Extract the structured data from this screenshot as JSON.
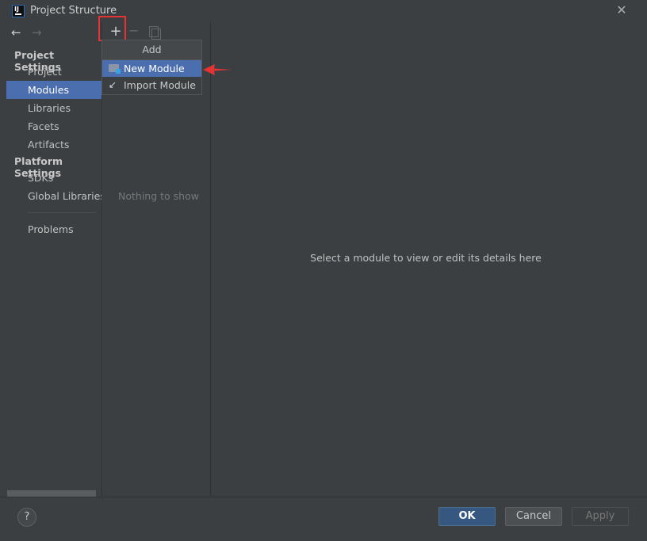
{
  "window": {
    "title": "Project Structure",
    "close_glyph": "✕"
  },
  "nav": {
    "back_glyph": "←",
    "forward_glyph": "→"
  },
  "sidebar": {
    "project_settings_title": "Project Settings",
    "project_items": [
      {
        "label": "Project",
        "selected": false
      },
      {
        "label": "Modules",
        "selected": true
      },
      {
        "label": "Libraries",
        "selected": false
      },
      {
        "label": "Facets",
        "selected": false
      },
      {
        "label": "Artifacts",
        "selected": false
      }
    ],
    "platform_settings_title": "Platform Settings",
    "platform_items": [
      {
        "label": "SDKs"
      },
      {
        "label": "Global Libraries"
      }
    ],
    "problems_label": "Problems"
  },
  "middle": {
    "add_glyph": "+",
    "remove_glyph": "−",
    "empty_text": "Nothing to show"
  },
  "popup": {
    "title": "Add",
    "items": [
      {
        "label": "New Module",
        "icon": "folder-module-icon",
        "highlighted": true
      },
      {
        "label": "Import Module",
        "icon": "import-icon",
        "highlighted": false
      }
    ]
  },
  "main": {
    "hint": "Select a module to view or edit its details here"
  },
  "footer": {
    "help_glyph": "?",
    "ok_label": "OK",
    "cancel_label": "Cancel",
    "apply_label": "Apply"
  },
  "colors": {
    "accent": "#4b6eaf",
    "primary_button": "#365880",
    "annotation_red": "#e53333"
  }
}
